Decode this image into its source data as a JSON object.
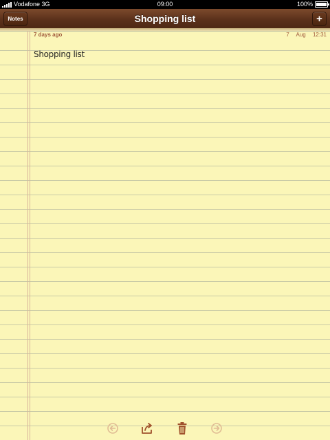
{
  "status_bar": {
    "carrier": "Vodafone 3G",
    "time": "09:00",
    "battery": "100%",
    "battery_level": 1.0
  },
  "nav_bar": {
    "title": "Shopping list",
    "notes_button": "Notes",
    "add_button": "+"
  },
  "note": {
    "relative_date": "7 days ago",
    "date": "7 Aug",
    "time": "12:31",
    "body": "Shopping list"
  },
  "toolbar": {
    "icons": [
      "previous-note-icon",
      "share-icon",
      "trash-icon",
      "next-note-icon"
    ]
  },
  "colors": {
    "paper": "#fbf6b8",
    "leather": "#5b311b",
    "accent": "#a05a3c"
  }
}
